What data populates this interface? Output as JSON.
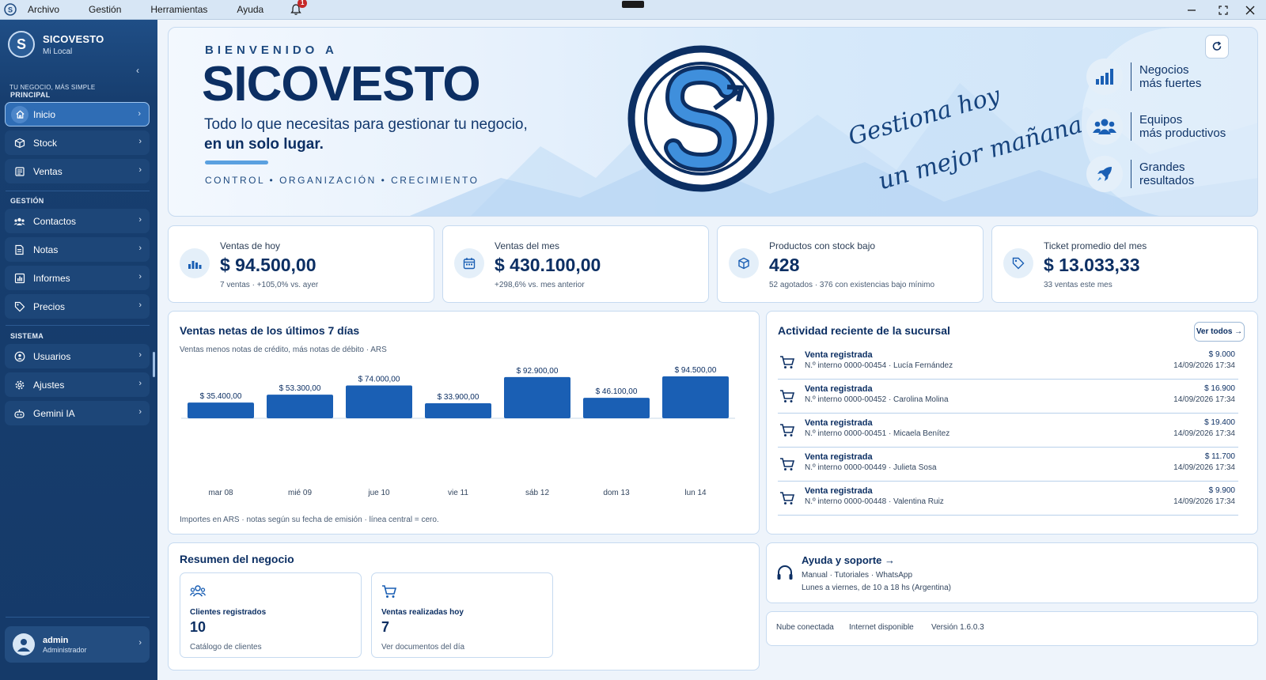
{
  "menubar": {
    "items": [
      "Archivo",
      "Gestión",
      "Herramientas",
      "Ayuda"
    ],
    "notification_count": "1"
  },
  "sidebar": {
    "brand_title": "SICOVESTO",
    "brand_subtitle": "Mi Local",
    "brand_logo_letter": "S",
    "tagline": "TU NEGOCIO, MÁS SIMPLE",
    "sections": {
      "principal": "PRINCIPAL",
      "gestion": "GESTIÓN",
      "sistema": "SISTEMA"
    },
    "items": {
      "inicio": "Inicio",
      "stock": "Stock",
      "ventas": "Ventas",
      "contactos": "Contactos",
      "notas": "Notas",
      "informes": "Informes",
      "precios": "Precios",
      "usuarios": "Usuarios",
      "ajustes": "Ajustes",
      "gemini": "Gemini IA"
    },
    "user": {
      "name": "admin",
      "role": "Administrador"
    }
  },
  "banner": {
    "welcome": "BIENVENIDO A",
    "title": "SICOVESTO",
    "line1": "Todo lo que necesitas para gestionar tu negocio,",
    "line2": "en un solo lugar.",
    "pillars": "CONTROL  •  ORGANIZACIÓN  •  CRECIMIENTO",
    "script_line1": "Gestiona hoy",
    "script_line2": "un mejor mañana",
    "values": [
      {
        "line1": "Negocios",
        "line2": "más fuertes",
        "icon": "bar-chart-icon"
      },
      {
        "line1": "Equipos",
        "line2": "más productivos",
        "icon": "team-icon"
      },
      {
        "line1": "Grandes",
        "line2": "resultados",
        "icon": "rocket-icon"
      }
    ]
  },
  "kpis": [
    {
      "label": "Ventas de hoy",
      "value": "$ 94.500,00",
      "note": "7 ventas · +105,0% vs. ayer",
      "icon": "chart-icon"
    },
    {
      "label": "Ventas del mes",
      "value": "$ 430.100,00",
      "note": "+298,6% vs. mes anterior",
      "icon": "calendar-icon"
    },
    {
      "label": "Productos con stock bajo",
      "value": "428",
      "note": "52 agotados · 376 con existencias bajo mínimo",
      "icon": "box-icon"
    },
    {
      "label": "Ticket promedio del mes",
      "value": "$ 13.033,33",
      "note": "33 ventas este mes",
      "icon": "tag-icon"
    }
  ],
  "sales_chart": {
    "title": "Ventas netas de los últimos 7 días",
    "subtitle": "Ventas menos notas de crédito, más notas de débito · ARS",
    "footnote": "Importes en ARS · notas según su fecha de emisión · línea central = cero."
  },
  "chart_data": {
    "type": "bar",
    "title": "Ventas netas de los últimos 7 días",
    "categories": [
      "mar 08",
      "mié 09",
      "jue 10",
      "vie 11",
      "sáb 12",
      "dom 13",
      "lun 14"
    ],
    "values": [
      35400,
      53300,
      74000,
      33900,
      92900,
      46100,
      94500
    ],
    "data_labels": [
      "$ 35.400,00",
      "$ 53.300,00",
      "$ 74.000,00",
      "$ 33.900,00",
      "$ 92.900,00",
      "$ 46.100,00",
      "$ 94.500,00"
    ],
    "unit": "ARS",
    "color": "#1a5fb4"
  },
  "activity": {
    "title": "Actividad reciente de la sucursal",
    "see_all": "Ver todos →",
    "rows": [
      {
        "title": "Venta registrada",
        "detail": "N.º interno 0000-00454 · Lucía Fernández",
        "amount": "$ 9.000",
        "date": "14/09/2026 17:34"
      },
      {
        "title": "Venta registrada",
        "detail": "N.º interno 0000-00452 · Carolina Molina",
        "amount": "$ 16.900",
        "date": "14/09/2026 17:34"
      },
      {
        "title": "Venta registrada",
        "detail": "N.º interno 0000-00451 · Micaela Benítez",
        "amount": "$ 19.400",
        "date": "14/09/2026 17:34"
      },
      {
        "title": "Venta registrada",
        "detail": "N.º interno 0000-00449 · Julieta Sosa",
        "amount": "$ 11.700",
        "date": "14/09/2026 17:34"
      },
      {
        "title": "Venta registrada",
        "detail": "N.º interno 0000-00448 · Valentina Ruiz",
        "amount": "$ 9.900",
        "date": "14/09/2026 17:34"
      }
    ]
  },
  "summary": {
    "title": "Resumen del negocio",
    "cards": [
      {
        "label": "Clientes registrados",
        "value": "10",
        "note": "Catálogo de clientes",
        "icon": "users-icon"
      },
      {
        "label": "Ventas realizadas hoy",
        "value": "7",
        "note": "Ver documentos del día",
        "icon": "cart-icon"
      }
    ]
  },
  "help": {
    "title": "Ayuda y soporte →",
    "links": "Manual · Tutoriales · WhatsApp",
    "hours": "Lunes a viernes, de 10 a 18 hs (Argentina)"
  },
  "status": {
    "cloud": "Nube conectada",
    "internet": "Internet disponible",
    "version": "Versión 1.6.0.3"
  },
  "colors": {
    "sidebar": "#173e6f",
    "accent": "#1a5fb4",
    "text_dark": "#0c2f63",
    "background": "#eef4fb"
  }
}
